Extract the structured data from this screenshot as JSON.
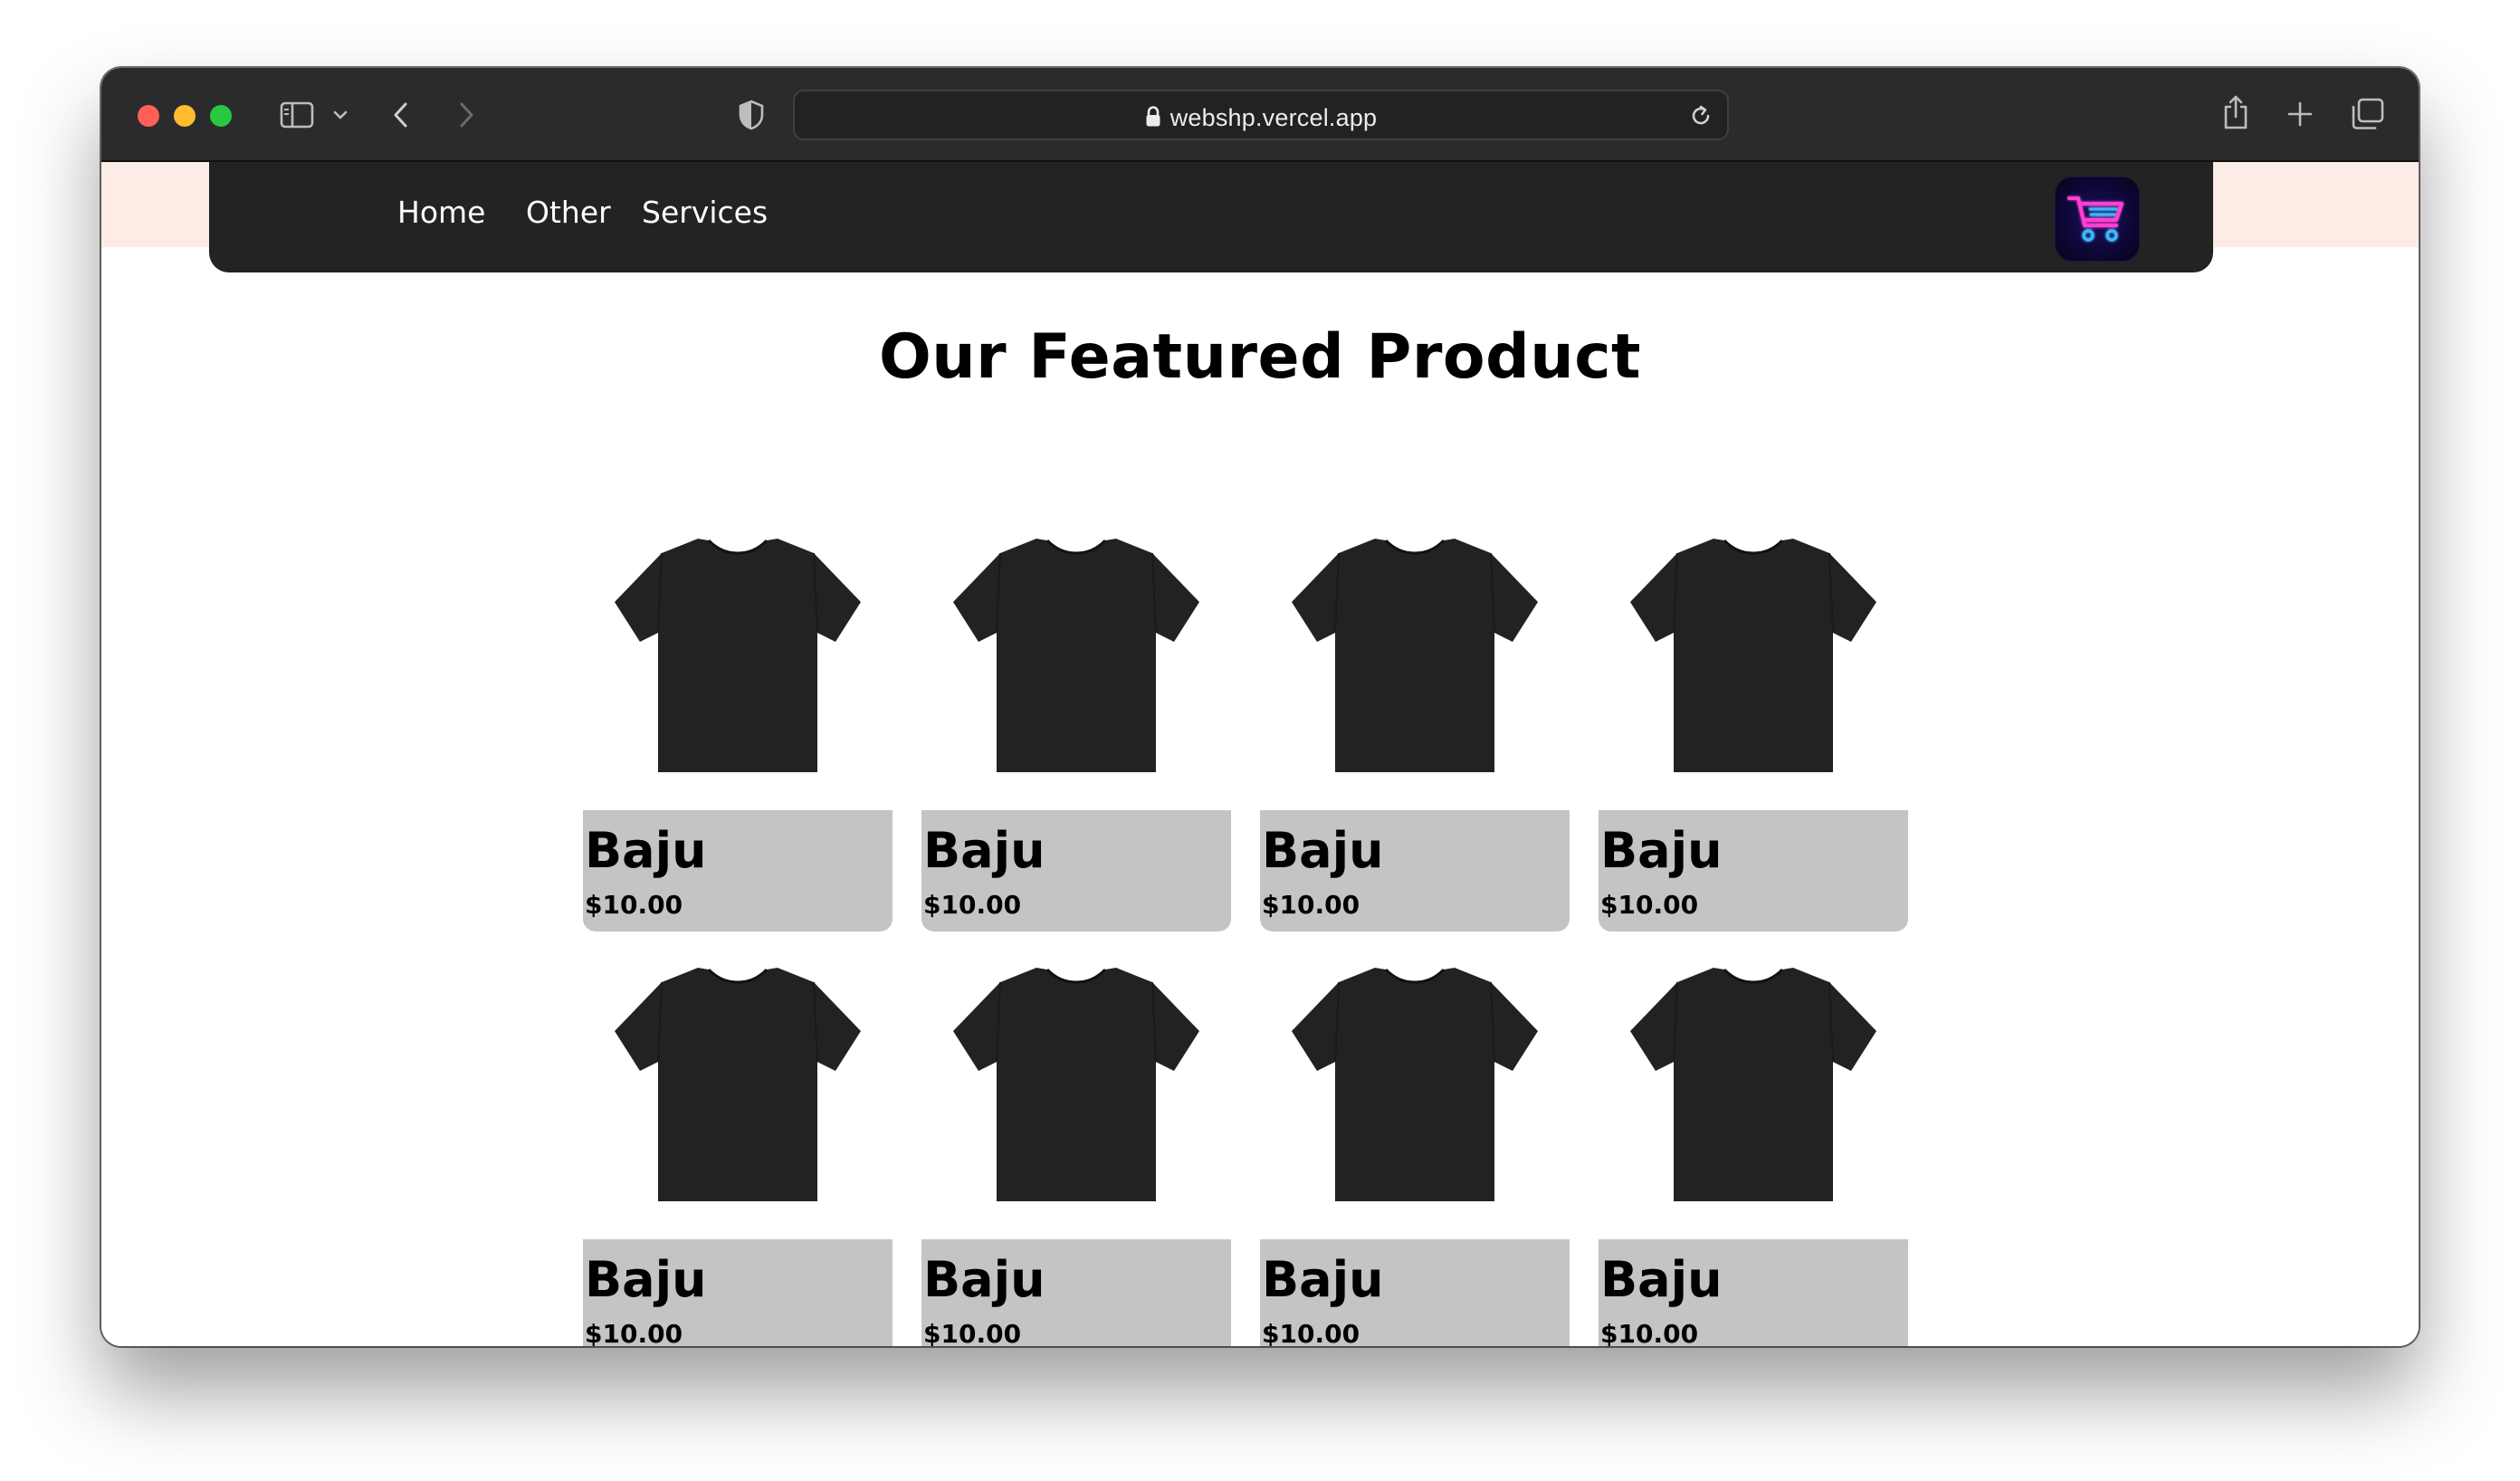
{
  "browser": {
    "url": "webshp.vercel.app"
  },
  "nav": {
    "links": [
      "Home",
      "Other",
      "Services"
    ]
  },
  "main": {
    "title": "Our Featured Product",
    "products": [
      {
        "name": "Baju",
        "price": "$10.00"
      },
      {
        "name": "Baju",
        "price": "$10.00"
      },
      {
        "name": "Baju",
        "price": "$10.00"
      },
      {
        "name": "Baju",
        "price": "$10.00"
      },
      {
        "name": "Baju",
        "price": "$10.00"
      },
      {
        "name": "Baju",
        "price": "$10.00"
      },
      {
        "name": "Baju",
        "price": "$10.00"
      },
      {
        "name": "Baju",
        "price": "$10.00"
      }
    ]
  },
  "colors": {
    "navbar": "#232323",
    "band": "#fdece6",
    "card_info": "#c4c4c4",
    "cart_neon_pink": "#ff3fd6",
    "cart_neon_blue": "#3fb6ff"
  },
  "icons": {
    "sidebar": "sidebar-icon",
    "chevron": "chevron-down-icon",
    "back": "back-arrow-icon",
    "forward": "forward-arrow-icon",
    "shield": "shield-icon",
    "lock": "lock-icon",
    "reload": "reload-icon",
    "share": "share-icon",
    "new_tab": "plus-icon",
    "tabs": "tabs-overview-icon",
    "cart": "cart-icon",
    "product": "tshirt-icon"
  }
}
